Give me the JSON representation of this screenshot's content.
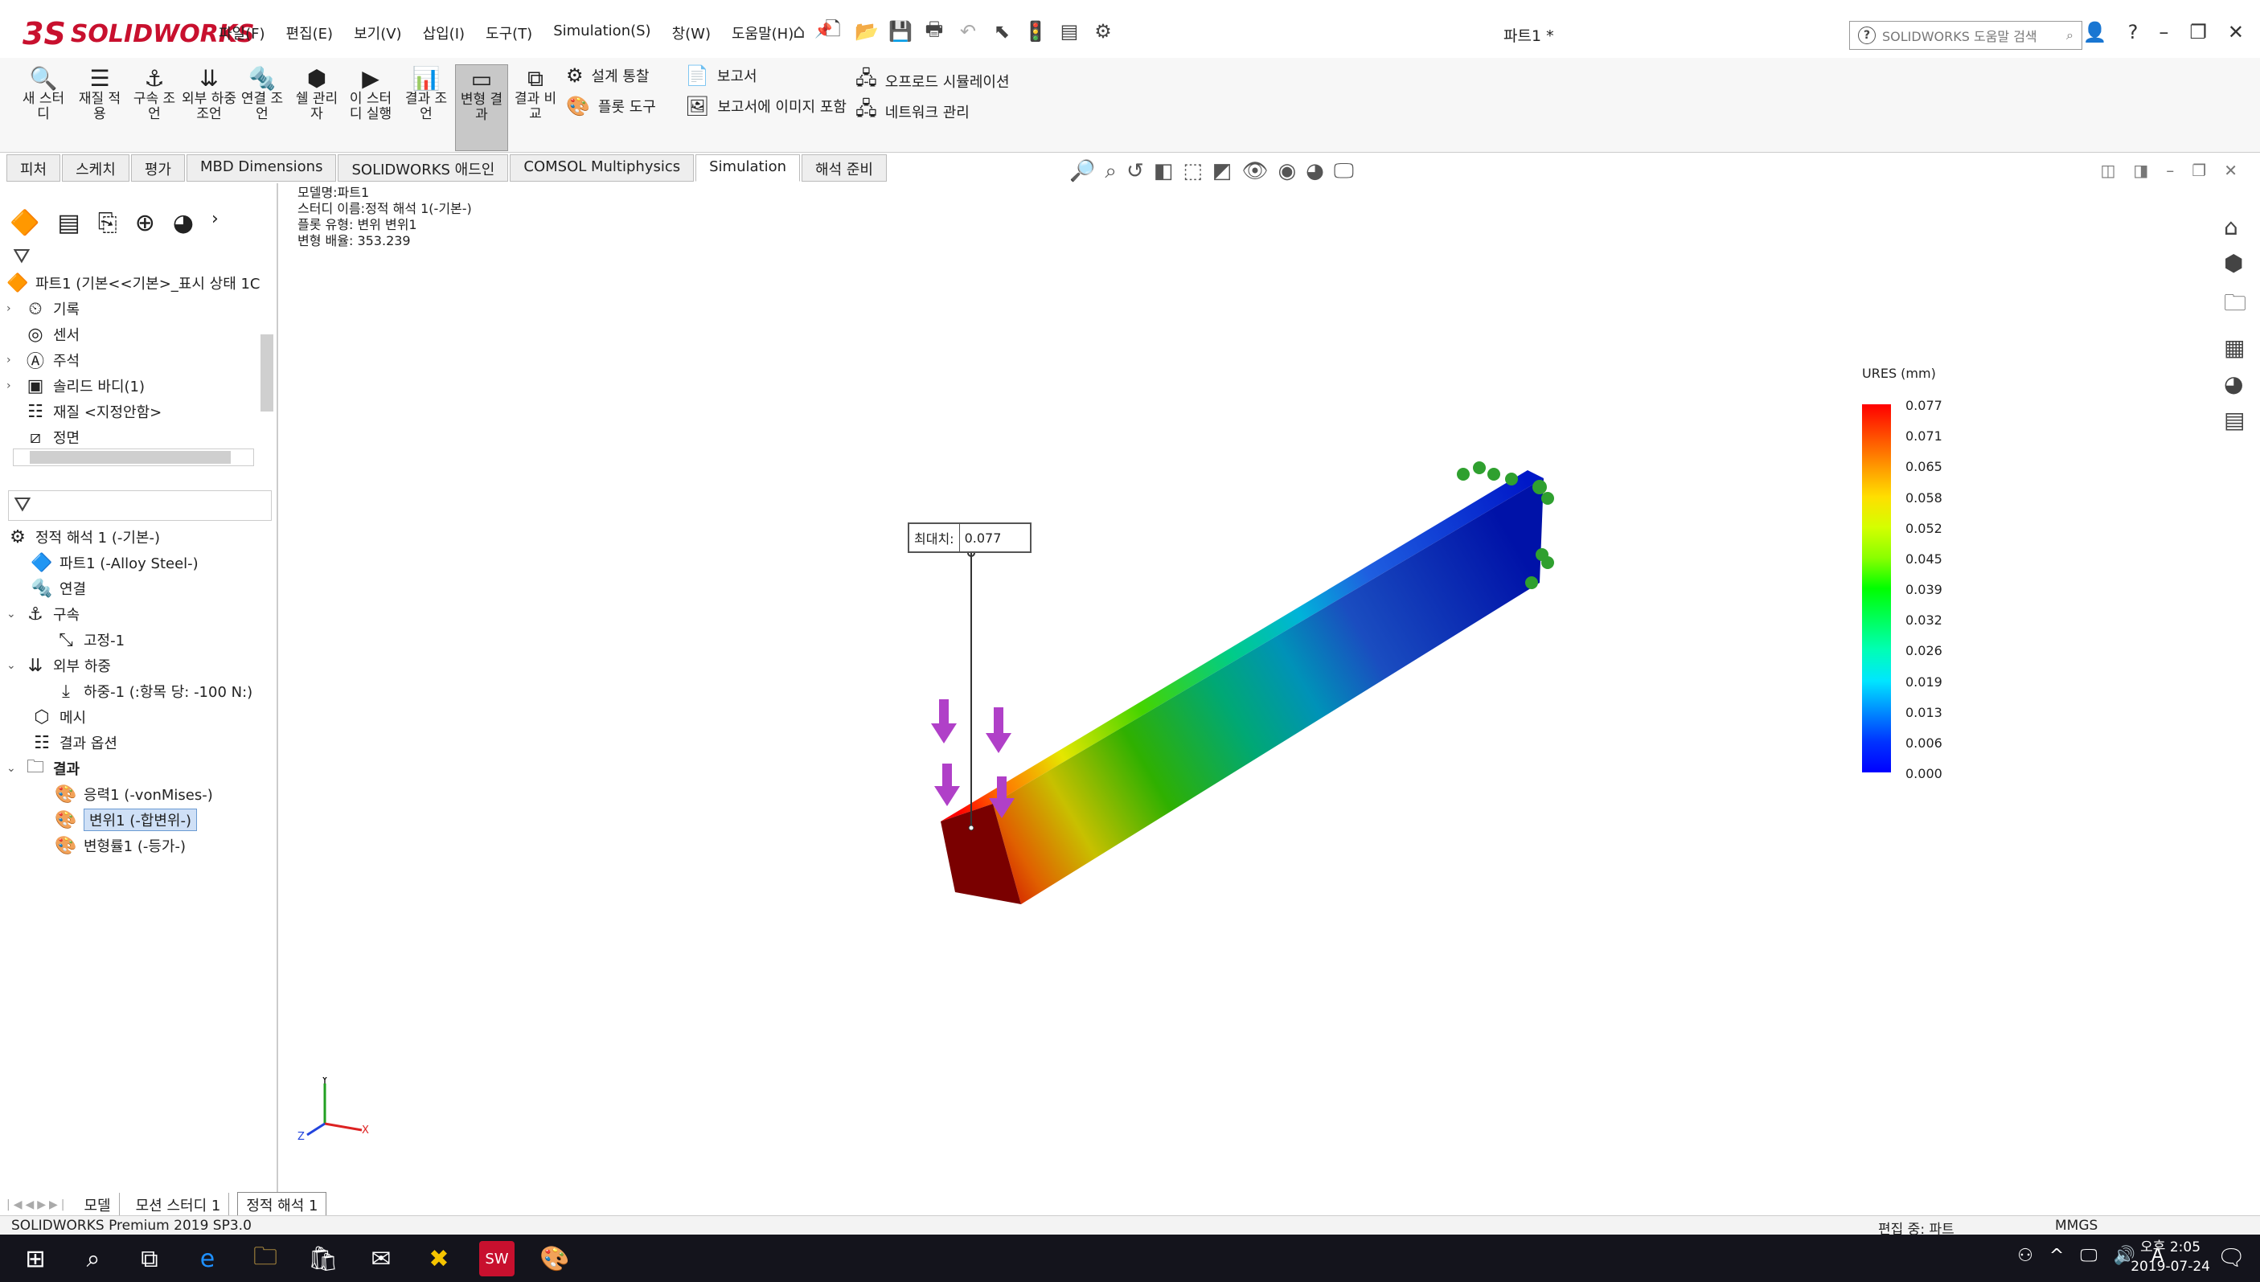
{
  "app": {
    "logo_text": "SOLIDWORKS",
    "logo_mark": "3S",
    "document_title": "파트1 *"
  },
  "menu": [
    "파일(F)",
    "편집(E)",
    "보기(V)",
    "삽입(I)",
    "도구(T)",
    "Simulation(S)",
    "창(W)",
    "도움말(H)"
  ],
  "search": {
    "placeholder": "SOLIDWORKS 도움말 검색"
  },
  "ribbon": {
    "buttons": [
      {
        "label": "새 스터디",
        "icon": "new-study-icon"
      },
      {
        "label": "재질 적용",
        "icon": "apply-material-icon"
      },
      {
        "label": "구속 조언",
        "icon": "fixtures-advisor-icon"
      },
      {
        "label": "외부 하중 조언",
        "icon": "external-loads-advisor-icon"
      },
      {
        "label": "연결 조언",
        "icon": "connections-advisor-icon"
      },
      {
        "label": "쉘 관리자",
        "icon": "shell-manager-icon"
      },
      {
        "label": "이 스터디 실행",
        "icon": "run-study-icon"
      },
      {
        "label": "결과 조언",
        "icon": "results-advisor-icon"
      },
      {
        "label": "변형 결과",
        "icon": "deformed-result-icon"
      },
      {
        "label": "결과 비교",
        "icon": "compare-results-icon"
      }
    ],
    "small": [
      "설계 통찰",
      "플롯 도구",
      "보고서",
      "보고서에 이미지 포함",
      "오프로드 시뮬레이션",
      "네트워크 관리"
    ]
  },
  "tabs": [
    "피처",
    "스케치",
    "평가",
    "MBD Dimensions",
    "SOLIDWORKS 애드인",
    "COMSOL Multiphysics",
    "Simulation",
    "해석 준비"
  ],
  "feature_tree": {
    "root": "파트1  (기본<<기본>_표시 상태 1C",
    "items": [
      "기록",
      "센서",
      "주석",
      "솔리드 바디(1)",
      "재질 <지정안함>",
      "정면"
    ]
  },
  "study_tree": {
    "root": "정적 해석 1 (-기본-)",
    "part": "파트1 (-Alloy Steel-)",
    "connections": "연결",
    "fixtures": "구속",
    "fixed": "고정-1",
    "loads": "외부 하중",
    "force": "하중-1 (:항목 당: -100 N:)",
    "mesh": "메시",
    "result_options": "결과 옵션",
    "results": "결과",
    "stress": "응력1 (-vonMises-)",
    "displacement": "변위1 (-합변위-)",
    "strain": "변형률1 (-등가-)"
  },
  "plot_info": [
    "모델명:파트1",
    "스터디 이름:정적 해석 1(-기본-)",
    "플롯 유형: 변위 변위1",
    "변형 배율: 353.239"
  ],
  "legend": {
    "title": "URES (mm)",
    "values": [
      "0.077",
      "0.071",
      "0.065",
      "0.058",
      "0.052",
      "0.045",
      "0.039",
      "0.032",
      "0.026",
      "0.019",
      "0.013",
      "0.006",
      "0.000"
    ],
    "colors": [
      "#ff0000",
      "#ff4a00",
      "#ff9500",
      "#ffdf00",
      "#d4ff00",
      "#8aff00",
      "#00ff00",
      "#00ff5a",
      "#00ffb4",
      "#00e6ff",
      "#008cff",
      "#0033ff",
      "#0000ff"
    ]
  },
  "annotation": {
    "label": "최대치:",
    "value": "0.077"
  },
  "axes": {
    "x": "X",
    "y": "Y",
    "z": "Z"
  },
  "bottom_tabs": [
    "모델",
    "모션 스터디 1",
    "정적 해석 1"
  ],
  "status": {
    "left": "SOLIDWORKS Premium 2019 SP3.0",
    "mode": "편집 중: 파트",
    "units": "MMGS"
  },
  "taskbar": {
    "time": "오후 2:05",
    "date": "2019-07-24",
    "ime": "A"
  }
}
